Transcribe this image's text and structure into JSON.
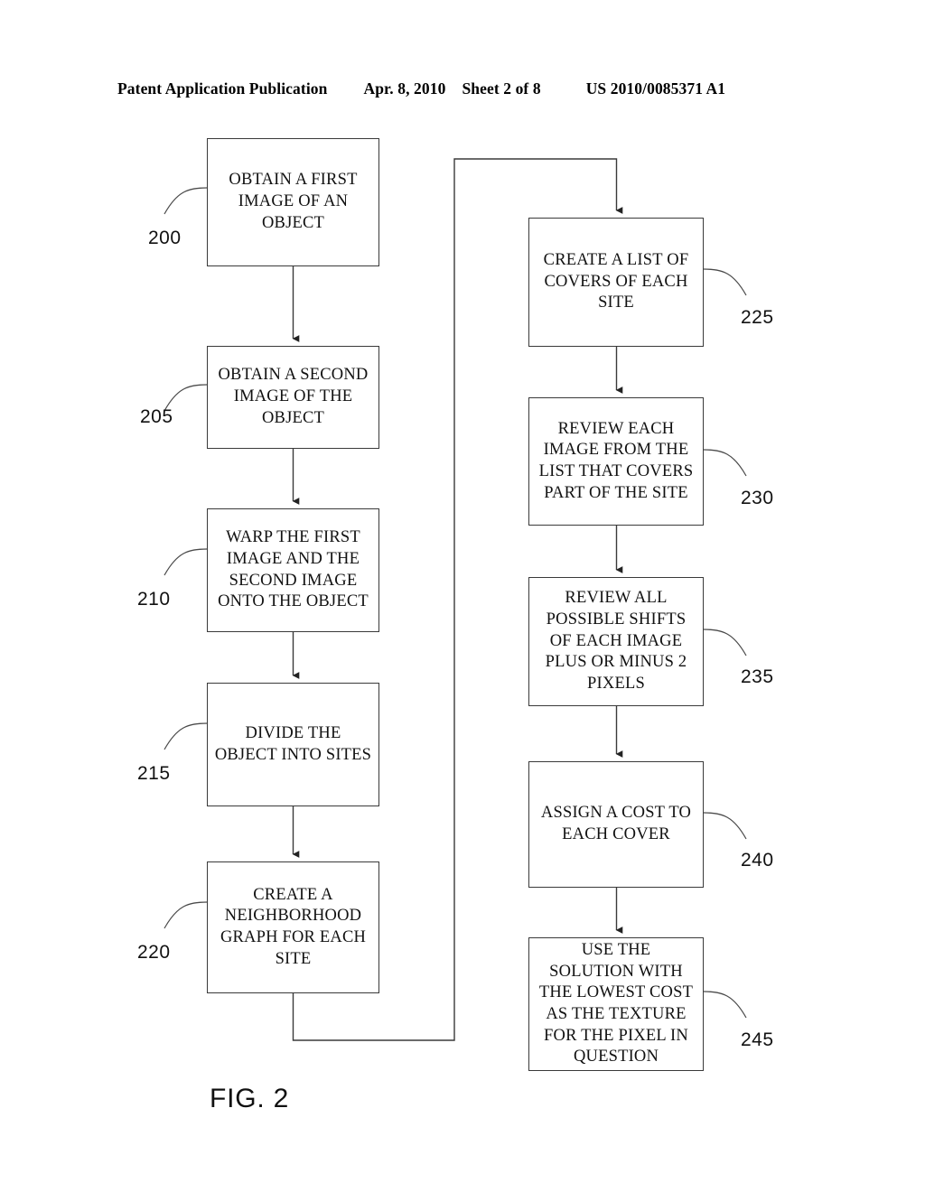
{
  "header": {
    "publication": "Patent Application Publication",
    "date": "Apr. 8, 2010",
    "sheet": "Sheet 2 of 8",
    "patent_number": "US 2010/0085371 A1"
  },
  "figure": {
    "caption": "FIG. 2",
    "type": "flowchart"
  },
  "flowchart": {
    "left_column": [
      {
        "ref": "200",
        "text": "OBTAIN A FIRST\nIMAGE OF AN\nOBJECT"
      },
      {
        "ref": "205",
        "text": "OBTAIN A SECOND\nIMAGE OF THE\nOBJECT"
      },
      {
        "ref": "210",
        "text": "WARP THE FIRST\nIMAGE AND THE\nSECOND IMAGE\nONTO THE OBJECT"
      },
      {
        "ref": "215",
        "text": "DIVIDE THE\nOBJECT INTO SITES"
      },
      {
        "ref": "220",
        "text": "CREATE A\nNEIGHBORHOOD\nGRAPH FOR EACH\nSITE"
      }
    ],
    "right_column": [
      {
        "ref": "225",
        "text": "CREATE A LIST OF\nCOVERS OF EACH\nSITE"
      },
      {
        "ref": "230",
        "text": "REVIEW EACH\nIMAGE FROM THE\nLIST THAT COVERS\nPART OF THE SITE"
      },
      {
        "ref": "235",
        "text": "REVIEW ALL\nPOSSIBLE SHIFTS\nOF EACH IMAGE\nPLUS OR MINUS 2\nPIXELS"
      },
      {
        "ref": "240",
        "text": "ASSIGN A COST TO\nEACH COVER"
      },
      {
        "ref": "245",
        "text": "USE THE\nSOLUTION WITH\nTHE LOWEST COST\nAS THE TEXTURE\nFOR THE PIXEL IN\nQUESTION"
      }
    ]
  },
  "colors": {
    "ink": "#111111",
    "box_border": "#3a3a3a",
    "page_background": "#ffffff"
  }
}
